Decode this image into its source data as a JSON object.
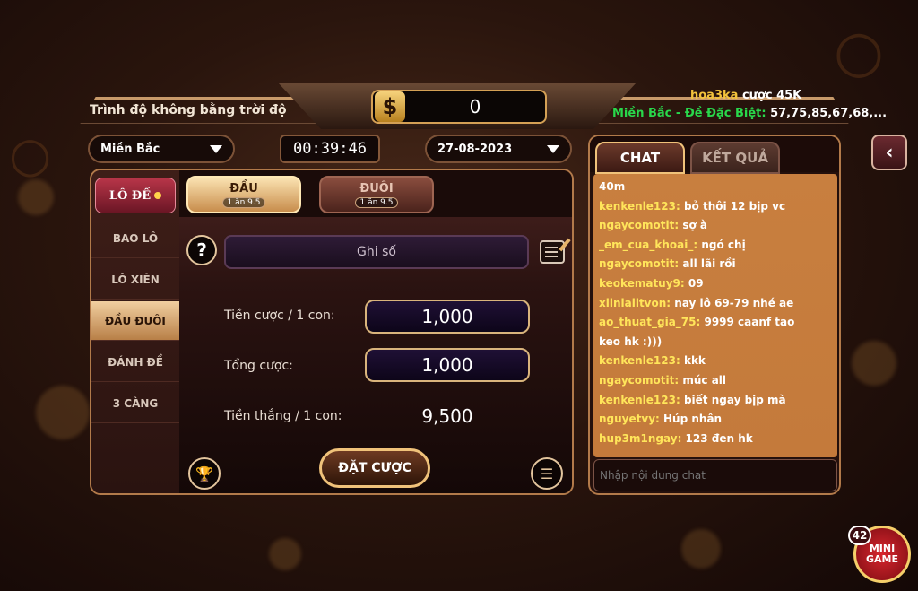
{
  "header": {
    "slogan": "Trình độ không bằng trời độ",
    "balance": "0",
    "currency_icon": "dollar-icon",
    "ticker_user": "hoa3ka",
    "ticker_action": " cược ",
    "ticker_amount": "45K",
    "result_label": "Miền Bắc - Đề Đặc Biệt:",
    "result_numbers": " 57,75,85,67,68,..."
  },
  "controls": {
    "region": "Miền Bắc",
    "timer": "00:39:46",
    "date": "27-08-2023"
  },
  "sidebar": {
    "logo": "LÔ ĐỀ",
    "items": [
      {
        "label": "BAO LÔ"
      },
      {
        "label": "LÔ XIÊN"
      },
      {
        "label": "ĐẦU ĐUÔI",
        "active": true
      },
      {
        "label": "ĐÁNH ĐỀ"
      },
      {
        "label": "3 CÀNG"
      }
    ]
  },
  "tabs": [
    {
      "label": "ĐẦU",
      "rate": "1 ăn 9.5",
      "active": true
    },
    {
      "label": "ĐUÔI",
      "rate": "1 ăn 9.5"
    }
  ],
  "form": {
    "help": "?",
    "number_placeholder": "Ghi số",
    "stake_label": "Tiền cược / 1 con:",
    "stake_value": "1,000",
    "total_label": "Tổng cược:",
    "total_value": "1,000",
    "win_label": "Tiền thắng / 1 con:",
    "win_value": "9,500",
    "bet_button": "ĐẶT CƯỢC"
  },
  "chat": {
    "tabs": [
      "CHAT",
      "KẾT QUẢ"
    ],
    "messages": [
      {
        "user": "",
        "text": "40m"
      },
      {
        "user": "kenkenle123:",
        "text": " bỏ thôi 12 bịp vc"
      },
      {
        "user": "ngaycomotit:",
        "text": " sợ à"
      },
      {
        "user": "_em_cua_khoai_:",
        "text": " ngó chị"
      },
      {
        "user": "ngaycomotit:",
        "text": " all lãi rồi"
      },
      {
        "user": "keokematuy9:",
        "text": " 09"
      },
      {
        "user": "xiinlaiitvon:",
        "text": " nay lô 69-79 nhé ae"
      },
      {
        "user": "ao_thuat_gia_75:",
        "text": " 9999  caanf tao"
      },
      {
        "user": "",
        "text": "keo hk :)))"
      },
      {
        "user": "kenkenle123:",
        "text": " kkk"
      },
      {
        "user": "ngaycomotit:",
        "text": " múc all"
      },
      {
        "user": "kenkenle123:",
        "text": " biết ngay bịp mà"
      },
      {
        "user": "nguyetvy:",
        "text": " Húp nhân"
      },
      {
        "user": "hup3m1ngay:",
        "text": " 123 đen hk"
      }
    ],
    "input_placeholder": "Nhập nội dung chat"
  },
  "minigame": {
    "badge": "42",
    "label_1": "MINI",
    "label_2": "GAME"
  },
  "colors": {
    "accent_gold": "#d4a055",
    "ticker_yellow": "#f3c33b",
    "ticker_green": "#29d84b",
    "chat_bg": "#c47a3b"
  }
}
